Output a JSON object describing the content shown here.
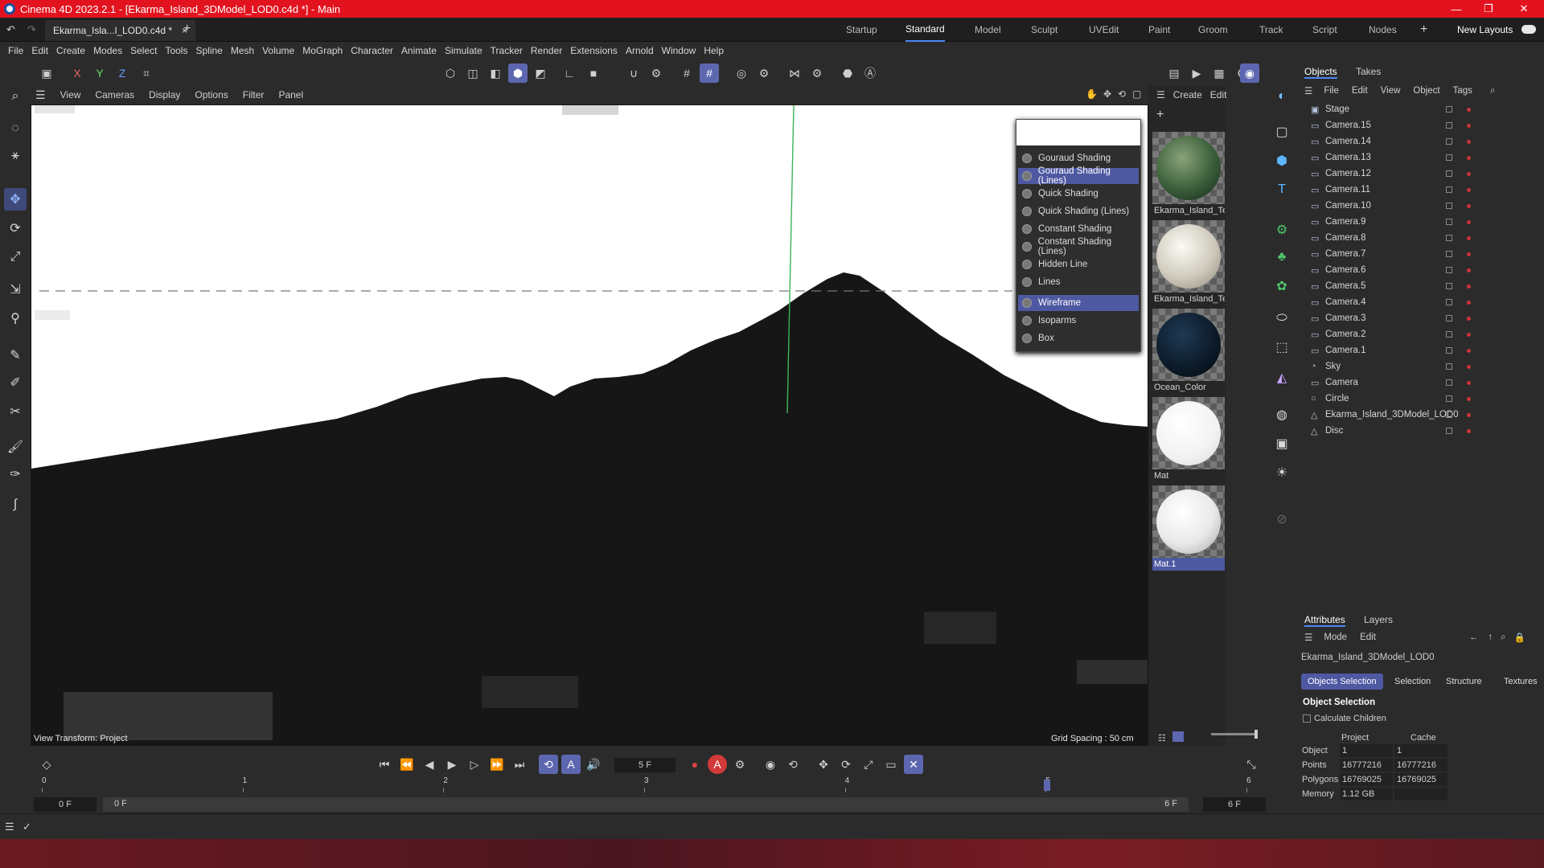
{
  "window": {
    "title": "Cinema 4D 2023.2.1 - [Ekarma_Island_3DModel_LOD0.c4d *] - Main",
    "min": "—",
    "max": "❐",
    "close": "✕"
  },
  "doc_tab": {
    "label": "Ekarma_Isla...l_LOD0.c4d *",
    "close": "×",
    "add": "+"
  },
  "layouts": [
    "Startup",
    "Standard",
    "Model",
    "Sculpt",
    "UVEdit",
    "Paint",
    "Groom",
    "Track",
    "Script",
    "Nodes"
  ],
  "active_layout": "Standard",
  "new_layouts": "New Layouts",
  "menu": [
    "File",
    "Edit",
    "Create",
    "Modes",
    "Select",
    "Tools",
    "Spline",
    "Mesh",
    "Volume",
    "MoGraph",
    "Character",
    "Animate",
    "Simulate",
    "Tracker",
    "Render",
    "Extensions",
    "Arnold",
    "Window",
    "Help"
  ],
  "toolbar": {
    "x": "X",
    "y": "Y",
    "z": "Z"
  },
  "viewport": {
    "menu": [
      "View",
      "Cameras",
      "Display",
      "Options",
      "Filter",
      "Panel"
    ],
    "view_transform": "View Transform: Project",
    "grid_spacing": "Grid Spacing : 50 cm"
  },
  "shading_menu": {
    "items": [
      "Gouraud Shading",
      "Gouraud Shading (Lines)",
      "Quick Shading",
      "Quick Shading (Lines)",
      "Constant Shading",
      "Constant Shading (Lines)",
      "Hidden Line",
      "Lines",
      "Wireframe",
      "Isoparms",
      "Box"
    ],
    "highlighted": [
      "Gouraud Shading (Lines)",
      "Wireframe"
    ]
  },
  "materials": {
    "menu": [
      "Create",
      "Edit"
    ],
    "items": [
      {
        "name": "Ekarma_Island_Te",
        "color": "#3b5f3a"
      },
      {
        "name": "Ekarma_Island_Te",
        "color": "#cfcabc"
      },
      {
        "name": "Ocean_Color",
        "color": "#0d1c2c"
      },
      {
        "name": "Mat",
        "color": "#f2f2f2"
      },
      {
        "name": "Mat.1",
        "color": "#e9e9e9"
      }
    ],
    "selected": "Mat.1"
  },
  "objects": {
    "tabs": [
      "Objects",
      "Takes"
    ],
    "menu": [
      "File",
      "Edit",
      "View",
      "Object",
      "Tags"
    ],
    "items": [
      "Stage",
      "Camera.15",
      "Camera.14",
      "Camera.13",
      "Camera.12",
      "Camera.11",
      "Camera.10",
      "Camera.9",
      "Camera.8",
      "Camera.7",
      "Camera.6",
      "Camera.5",
      "Camera.4",
      "Camera.3",
      "Camera.2",
      "Camera.1",
      "Sky",
      "Camera",
      "Circle",
      "Ekarma_Island_3DModel_LOD0",
      "Disc"
    ]
  },
  "attributes": {
    "tabs": [
      "Attributes",
      "Layers"
    ],
    "menu": [
      "Mode",
      "Edit"
    ],
    "object_name": "Ekarma_Island_3DModel_LOD0",
    "subtabs": [
      "Objects Selection",
      "Selection",
      "Structure",
      "Textures"
    ],
    "section": "Object Selection",
    "calc_children": "Calculate Children",
    "columns": [
      "Project",
      "Cache"
    ],
    "rows": [
      {
        "label": "Object",
        "project": "1",
        "cache": "1"
      },
      {
        "label": "Points",
        "project": "16777216",
        "cache": "16777216"
      },
      {
        "label": "Polygons",
        "project": "16769025",
        "cache": "16769025"
      },
      {
        "label": "Memory",
        "project": "1.12 GB",
        "cache": ""
      }
    ]
  },
  "timeline": {
    "frame": "5 F",
    "ticks": [
      "0",
      "1",
      "2",
      "3",
      "4",
      "5",
      "6"
    ],
    "start": "0 F",
    "start2": "0 F",
    "end": "6 F",
    "end2": "6 F",
    "current_frame": 5,
    "total_frames": 6
  }
}
